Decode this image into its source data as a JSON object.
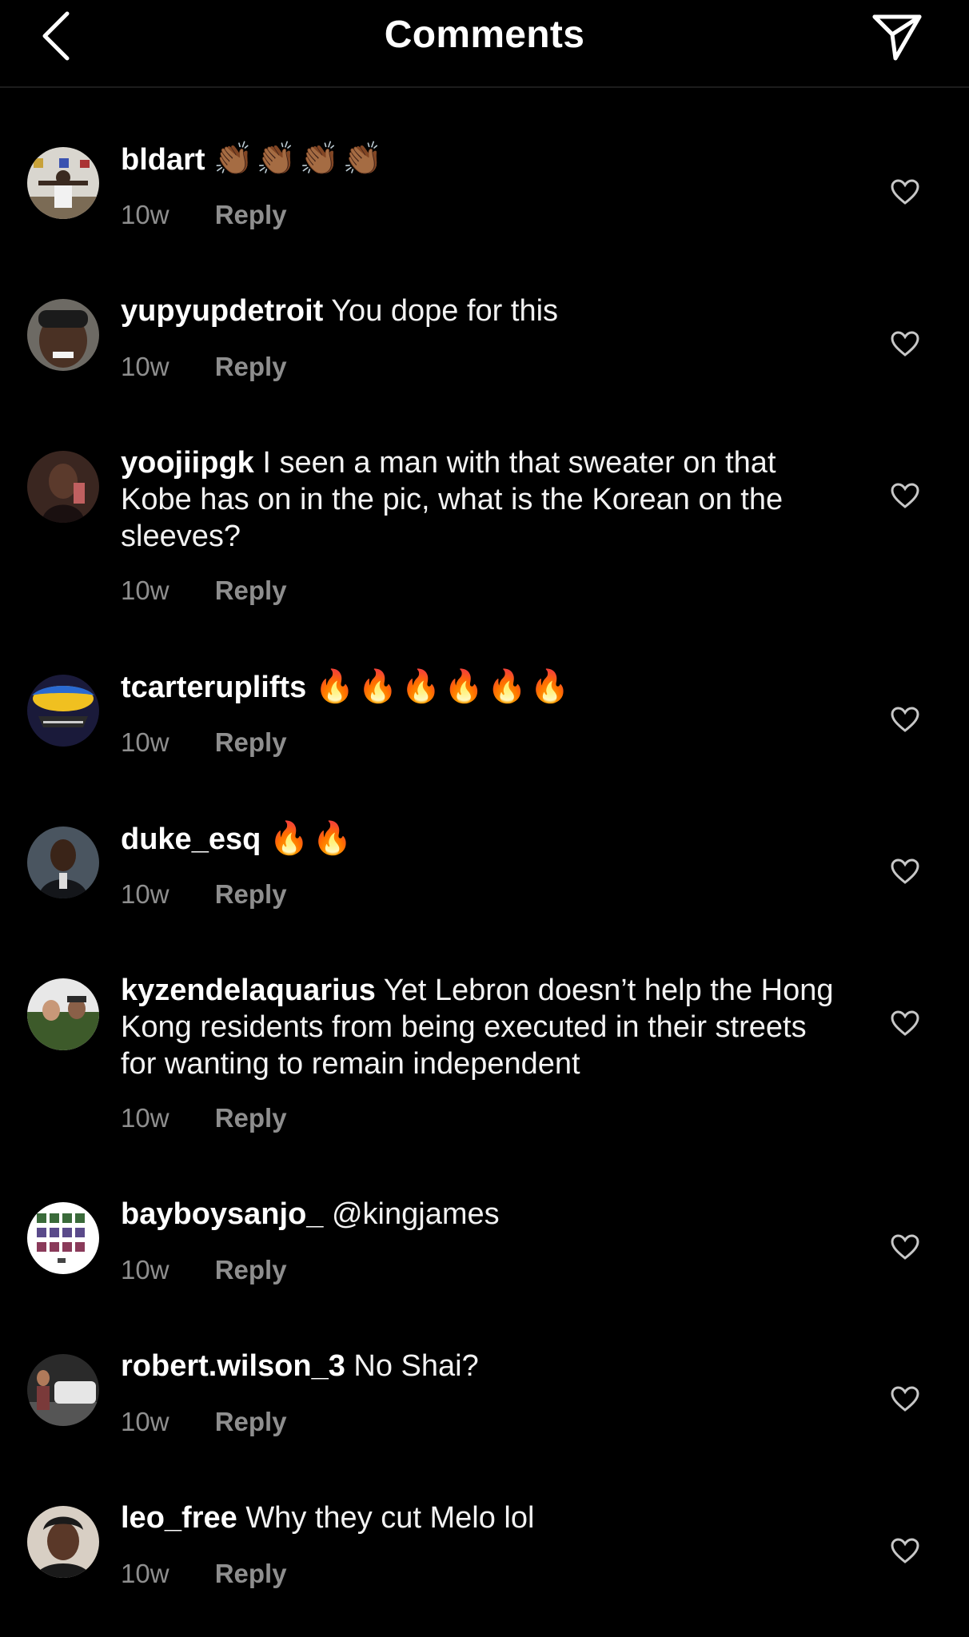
{
  "header": {
    "title": "Comments",
    "back_icon": "chevron-left-icon",
    "send_icon": "paper-plane-icon"
  },
  "comments": [
    {
      "username": "bldart",
      "text": "",
      "emoji": "👏🏾👏🏾👏🏾👏🏾",
      "time": "10w",
      "reply": "Reply"
    },
    {
      "username": "yupyupdetroit",
      "text": "You dope for this",
      "emoji": "",
      "time": "10w",
      "reply": "Reply"
    },
    {
      "username": "yoojiipgk",
      "text": "I seen a man with that sweater on that Kobe has on in the pic, what is the Korean on the sleeves?",
      "emoji": "",
      "time": "10w",
      "reply": "Reply"
    },
    {
      "username": "tcarteruplifts",
      "text": "",
      "emoji": "🔥🔥🔥🔥🔥🔥",
      "time": "10w",
      "reply": "Reply"
    },
    {
      "username": "duke_esq",
      "text": "",
      "emoji": "🔥🔥",
      "time": "10w",
      "reply": "Reply"
    },
    {
      "username": "kyzendelaquarius",
      "text": "Yet Lebron doesn’t help the Hong Kong residents from being executed in their streets for wanting to remain independent",
      "emoji": "",
      "time": "10w",
      "reply": "Reply"
    },
    {
      "username": "bayboysanjo_",
      "text": "@kingjames",
      "emoji": "",
      "time": "10w",
      "reply": "Reply"
    },
    {
      "username": "robert.wilson_3",
      "text": "No Shai?",
      "emoji": "",
      "time": "10w",
      "reply": "Reply"
    },
    {
      "username": "leo_free",
      "text": "Why they cut Melo lol",
      "emoji": "",
      "time": "10w",
      "reply": "Reply"
    }
  ],
  "colors": {
    "background": "#000000",
    "text_primary": "#ffffff",
    "text_secondary": "#8e8e8e",
    "divider": "#1c1c1c"
  }
}
